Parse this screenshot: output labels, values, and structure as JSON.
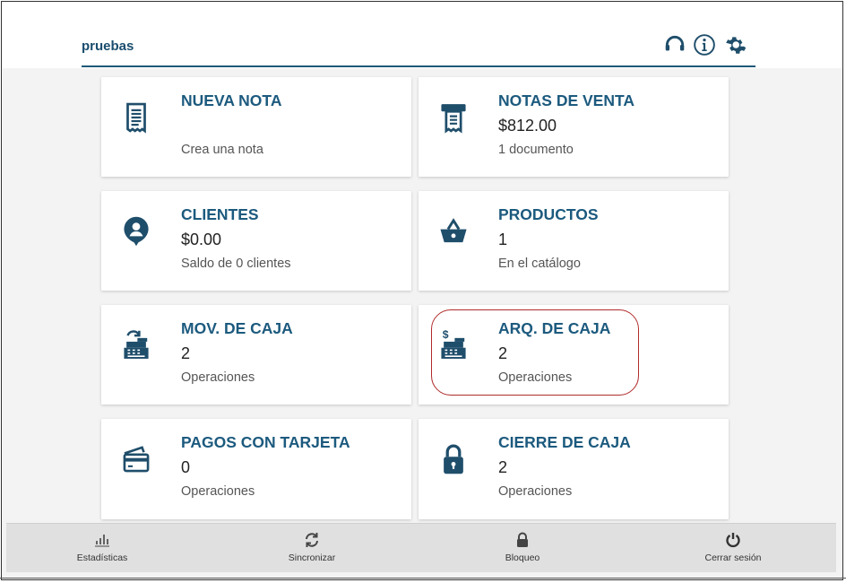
{
  "header": {
    "title": "pruebas",
    "icons": [
      "headset-icon",
      "info-icon",
      "gear-icon"
    ]
  },
  "cards": {
    "nueva_nota": {
      "title": "NUEVA NOTA",
      "value": "",
      "subtitle": "Crea una nota",
      "icon": "receipt-icon"
    },
    "notas_venta": {
      "title": "NOTAS DE VENTA",
      "value": "$812.00",
      "subtitle": "1 documento",
      "icon": "printer-receipt-icon"
    },
    "clientes": {
      "title": "CLIENTES",
      "value": "$0.00",
      "subtitle": "Saldo de 0 clientes",
      "icon": "user-pin-icon"
    },
    "productos": {
      "title": "PRODUCTOS",
      "value": "1",
      "subtitle": "En el catálogo",
      "icon": "basket-icon"
    },
    "mov_caja": {
      "title": "MOV. DE CAJA",
      "value": "2",
      "subtitle": "Operaciones",
      "icon": "cash-register-refresh-icon"
    },
    "arq_caja": {
      "title": "ARQ. DE CAJA",
      "value": "2",
      "subtitle": "Operaciones",
      "icon": "cash-register-dollar-icon"
    },
    "pagos_tarjeta": {
      "title": "PAGOS CON TARJETA",
      "value": "0",
      "subtitle": "Operaciones",
      "icon": "credit-cards-icon"
    },
    "cierre_caja": {
      "title": "CIERRE DE CAJA",
      "value": "2",
      "subtitle": "Operaciones",
      "icon": "padlock-icon"
    }
  },
  "bottom_nav": {
    "estadisticas": "Estadísticas",
    "sincronizar": "Sincronizar",
    "bloqueo": "Bloqueo",
    "cerrar_sesion": "Cerrar sesión"
  },
  "colors": {
    "accent": "#1c5a7e",
    "icon": "#1f4e6b",
    "highlight": "#b02a2a",
    "background": "#f3f3f3"
  }
}
